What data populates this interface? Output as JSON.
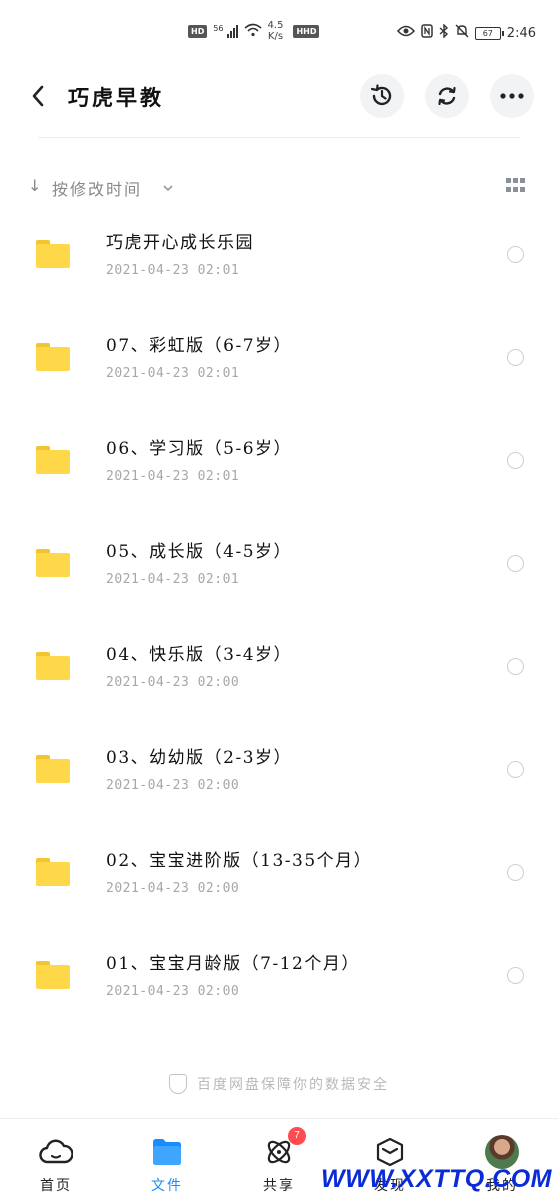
{
  "status_bar": {
    "hd_chip": "HD",
    "signal": "56",
    "speed_value": "4.5",
    "speed_unit": "K/s",
    "nfc_chip": "HHD",
    "battery": "67",
    "time": "2:46"
  },
  "header": {
    "title": "巧虎早教",
    "back_icon": "chevron-left-icon",
    "history_icon": "history-icon",
    "refresh_icon": "refresh-icon",
    "more_icon": "more-icon"
  },
  "sort": {
    "label": "按修改时间"
  },
  "files": [
    {
      "name": "巧虎开心成长乐园",
      "date": "2021-04-23  02:01"
    },
    {
      "name": "07、彩虹版（6-7岁）",
      "date": "2021-04-23  02:01"
    },
    {
      "name": "06、学习版（5-6岁）",
      "date": "2021-04-23  02:01"
    },
    {
      "name": "05、成长版（4-5岁）",
      "date": "2021-04-23  02:01"
    },
    {
      "name": "04、快乐版（3-4岁）",
      "date": "2021-04-23  02:00"
    },
    {
      "name": "03、幼幼版（2-3岁）",
      "date": "2021-04-23  02:00"
    },
    {
      "name": "02、宝宝进阶版（13-35个月）",
      "date": "2021-04-23  02:00"
    },
    {
      "name": "01、宝宝月龄版（7-12个月）",
      "date": "2021-04-23  02:00"
    }
  ],
  "footer_note": "百度网盘保障你的数据安全",
  "nav": {
    "home": "首页",
    "files": "文件",
    "share": "共享",
    "share_badge": "7",
    "discover": "发现",
    "me": "我的"
  },
  "watermark": "WWW.XXTTQ.COM",
  "colors": {
    "accent": "#1a8cff",
    "folder": "#ffd84a",
    "badge": "#ff4d4f"
  }
}
